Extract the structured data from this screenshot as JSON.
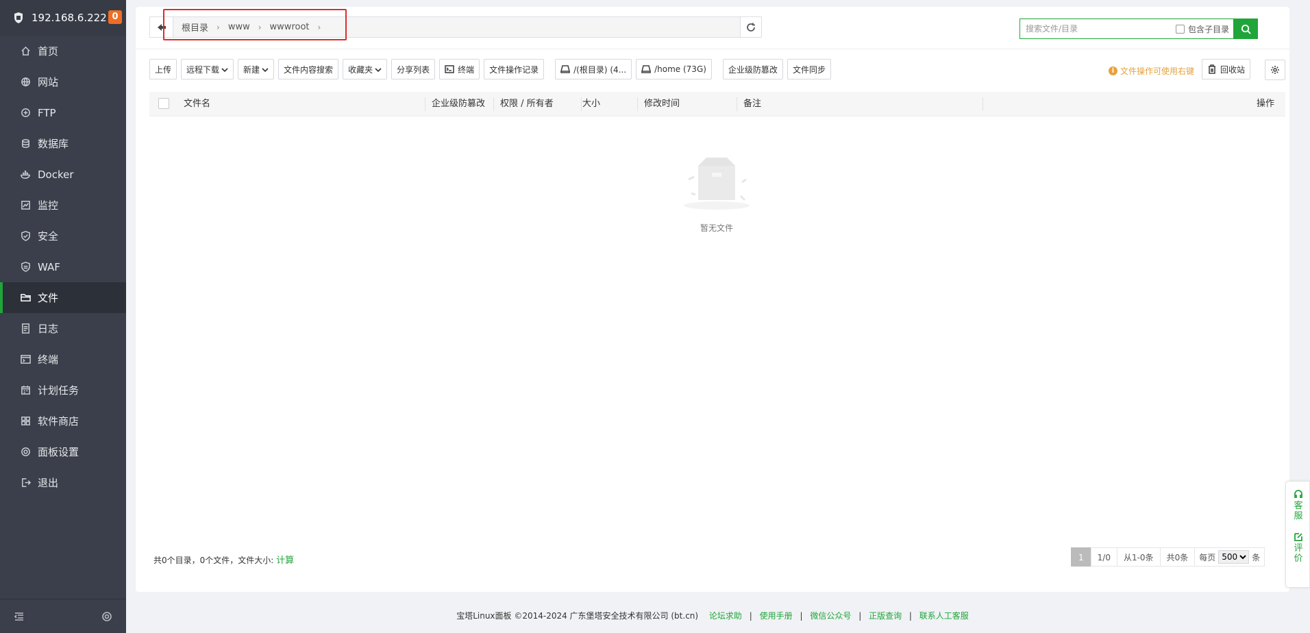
{
  "sidebar": {
    "ip": "192.168.6.222",
    "badge": "0",
    "items": [
      {
        "label": "首页",
        "icon": "home-icon"
      },
      {
        "label": "网站",
        "icon": "globe-icon"
      },
      {
        "label": "FTP",
        "icon": "ftp-icon"
      },
      {
        "label": "数据库",
        "icon": "database-icon"
      },
      {
        "label": "Docker",
        "icon": "docker-icon"
      },
      {
        "label": "监控",
        "icon": "monitor-icon"
      },
      {
        "label": "安全",
        "icon": "shield-icon"
      },
      {
        "label": "WAF",
        "icon": "waf-shield-icon"
      },
      {
        "label": "文件",
        "icon": "folder-icon"
      },
      {
        "label": "日志",
        "icon": "log-icon"
      },
      {
        "label": "终端",
        "icon": "terminal-icon"
      },
      {
        "label": "计划任务",
        "icon": "calendar-icon"
      },
      {
        "label": "软件商店",
        "icon": "apps-grid-icon"
      },
      {
        "label": "面板设置",
        "icon": "gear-icon"
      },
      {
        "label": "退出",
        "icon": "logout-icon"
      }
    ],
    "active_index": 8
  },
  "path": {
    "crumbs": [
      "根目录",
      "www",
      "wwwroot"
    ]
  },
  "search": {
    "placeholder": "搜索文件/目录",
    "include_subdir_label": "包含子目录"
  },
  "toolbar": {
    "upload": "上传",
    "remote_download": "远程下载",
    "new": "新建",
    "content_search": "文件内容搜索",
    "favorites": "收藏夹",
    "share_list": "分享列表",
    "terminal": "终端",
    "op_log": "文件操作记录",
    "disk_root": "/(根目录) (4...",
    "disk_home": "/home (73G)",
    "tamper": "企业级防篡改",
    "sync": "文件同步",
    "tip": "文件操作可使用右键",
    "recycle": "回收站"
  },
  "table": {
    "headers": {
      "name": "文件名",
      "tamper": "企业级防篡改",
      "perm": "权限 / 所有者",
      "size": "大小",
      "mtime": "修改时间",
      "remark": "备注",
      "action": "操作"
    },
    "empty_text": "暂无文件"
  },
  "summary": {
    "text": "共0个目录，0个文件，文件大小:",
    "calc": "计算"
  },
  "pager": {
    "current": "1",
    "pages": "1/0",
    "range": "从1-0条",
    "total": "共0条",
    "per_page_label": "每页",
    "per_page_value": "500",
    "unit": "条"
  },
  "footer": {
    "copyright": "宝塔Linux面板 ©2014-2024 广东堡塔安全技术有限公司 (bt.cn)",
    "links": [
      "论坛求助",
      "使用手册",
      "微信公众号",
      "正版查询",
      "联系人工客服"
    ]
  },
  "float": {
    "service": [
      "客",
      "服"
    ],
    "review": [
      "评",
      "价"
    ]
  },
  "colors": {
    "accent": "#20a53a",
    "sidebar_bg": "#3a3f4b",
    "highlight": "#e02a2a",
    "badge": "#f06d23",
    "tip": "#e6a23c"
  }
}
